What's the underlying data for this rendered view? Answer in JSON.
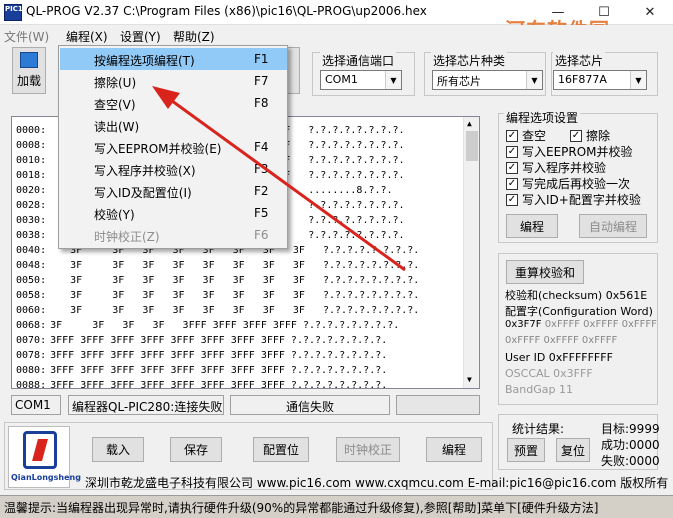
{
  "window": {
    "title": "QL-PROG V2.37  C:\\Program Files (x86)\\pic16\\QL-PROG\\up2006.hex",
    "icon_label": "PIC16",
    "watermark": "河东软件园"
  },
  "menubar": {
    "items": [
      "编程(X)",
      "设置(Y)",
      "帮助(Z)"
    ],
    "hidden_left": "文件(W)"
  },
  "toolbar": {
    "load_label": "加载"
  },
  "port": {
    "label": "选择通信端口",
    "value": "COM1"
  },
  "chiptype": {
    "label": "选择芯片种类",
    "value": "所有芯片"
  },
  "chip": {
    "label": "选择芯片",
    "value": "16F877A"
  },
  "hex": {
    "rows": [
      {
        "addr": "0000:",
        "tail": "3FFF   ?.?.?.?.?.?.?.?."
      },
      {
        "addr": "0008:",
        "tail": "3FFF   ?.?.?.?.?.?.?.?."
      },
      {
        "addr": "0010:",
        "tail": "3FFF   ?.?.?.?.?.?.?.?."
      },
      {
        "addr": "0018:",
        "tail": "19FF   ?.?.?.?.?.?.?.?."
      },
      {
        "addr": "0020:",
        "tail": "3F     ........8.?.?."
      },
      {
        "addr": "0028:",
        "tail": "3F     ?.?.?.?.?.?.?.?."
      },
      {
        "addr": "0030:",
        "tail": "3F     ?.?.?.?.?.?.?.?."
      },
      {
        "addr": "0038:",
        "tail": "3F     ?.?.?.?.?.?.?.?."
      },
      {
        "addr": "0040:",
        "tail": "3F     3F   3F   3F   3F   3F   3F   3F   ?.?.?.?.?.?.?.?."
      },
      {
        "addr": "0048:",
        "tail": "3F     3F   3F   3F   3F   3F   3F   3F   ?.?.?.?.?.?.?.?."
      },
      {
        "addr": "0050:",
        "tail": "3F     3F   3F   3F   3F   3F   3F   3F   ?.?.?.?.?.?.?.?."
      },
      {
        "addr": "0058:",
        "tail": "3F     3F   3F   3F   3F   3F   3F   3F   ?.?.?.?.?.?.?.?."
      },
      {
        "addr": "0060:",
        "tail": "3F     3F   3F   3F   3F   3F   3F   3F   ?.?.?.?.?.?.?.?."
      },
      {
        "addr": "0068:",
        "tail": "3F     3F   3F   3F   3FFF 3FFF 3FFF 3FFF ?.?.?.?.?.?.?.?."
      },
      {
        "addr": "0070:",
        "tail": "3FFF 3FFF 3FFF 3FFF 3FFF 3FFF 3FFF 3FFF ?.?.?.?.?.?.?.?."
      },
      {
        "addr": "0078:",
        "tail": "3FFF 3FFF 3FFF 3FFF 3FFF 3FFF 3FFF 3FFF ?.?.?.?.?.?.?.?."
      },
      {
        "addr": "0080:",
        "tail": "3FFF 3FFF 3FFF 3FFF 3FFF 3FFF 3FFF 3FFF ?.?.?.?.?.?.?.?."
      },
      {
        "addr": "0088:",
        "tail": "3FFF 3FFF 3FFF 3FFF 3FFF 3FFF 3FFF 3FFF ?.?.?.?.?.?.?.?."
      }
    ]
  },
  "options": {
    "title": "编程选项设置",
    "items": [
      "查空",
      "擦除",
      "写入EEPROM并校验",
      "写入程序并校验",
      "写完成后再校验一次",
      "写入ID+配置字并校验"
    ],
    "program_btn": "编程",
    "auto_program_btn": "自动编程"
  },
  "checksum": {
    "recalc_btn": "重算校验和",
    "checksum_line": "校验和(checksum) 0x561E",
    "config_title": "配置字(Configuration Word)",
    "config_line1": "0x3F7F 0xFFFF 0xFFFF 0xFFFF",
    "config_line2": "0xFFFF 0xFFFF 0xFFFF",
    "user_id": "User ID  0xFFFFFFFF",
    "osccal": "OSCCAL   0x3FFF",
    "bandgap": "BandGap  11"
  },
  "status": {
    "port": "COM1",
    "programmer": "编程器QL-PIC280:连接失败",
    "comm": "通信失败"
  },
  "buttons": {
    "load": "载入",
    "save": "保存",
    "config": "配置位",
    "clock": "时钟校正",
    "program": "编程"
  },
  "stats": {
    "title": "统计结果:",
    "target": "目标:9999",
    "success": "成功:0000",
    "fail": "失败:0000",
    "preset": "预置",
    "reset": "复位"
  },
  "logo": {
    "text": "QianLongsheng"
  },
  "company": "深圳市乾龙盛电子科技有限公司  www.pic16.com  www.cxqmcu.com  E-mail:pic16@pic16.com  版权所有",
  "hint": "温馨提示:当编程器出现异常时,请执行硬件升级(90%的异常都能通过升级修复),参照[帮助]菜单下[硬件升级方法]",
  "dropdown": {
    "items": [
      {
        "label": "按编程选项编程(T)",
        "key": "F1"
      },
      {
        "label": "擦除(U)",
        "key": "F7"
      },
      {
        "label": "查空(V)",
        "key": "F8"
      },
      {
        "label": "读出(W)",
        "key": ""
      },
      {
        "label": "写入EEPROM并校验(E)",
        "key": "F4"
      },
      {
        "label": "写入程序并校验(X)",
        "key": "F3"
      },
      {
        "label": "写入ID及配置位(I)",
        "key": "F2"
      },
      {
        "label": "校验(Y)",
        "key": "F5"
      },
      {
        "label": "时钟校正(Z)",
        "key": "F6"
      }
    ]
  },
  "colors": {
    "highlight": "#91c9f7",
    "arrow": "#d9231d",
    "watermark": "#e06a1f"
  }
}
